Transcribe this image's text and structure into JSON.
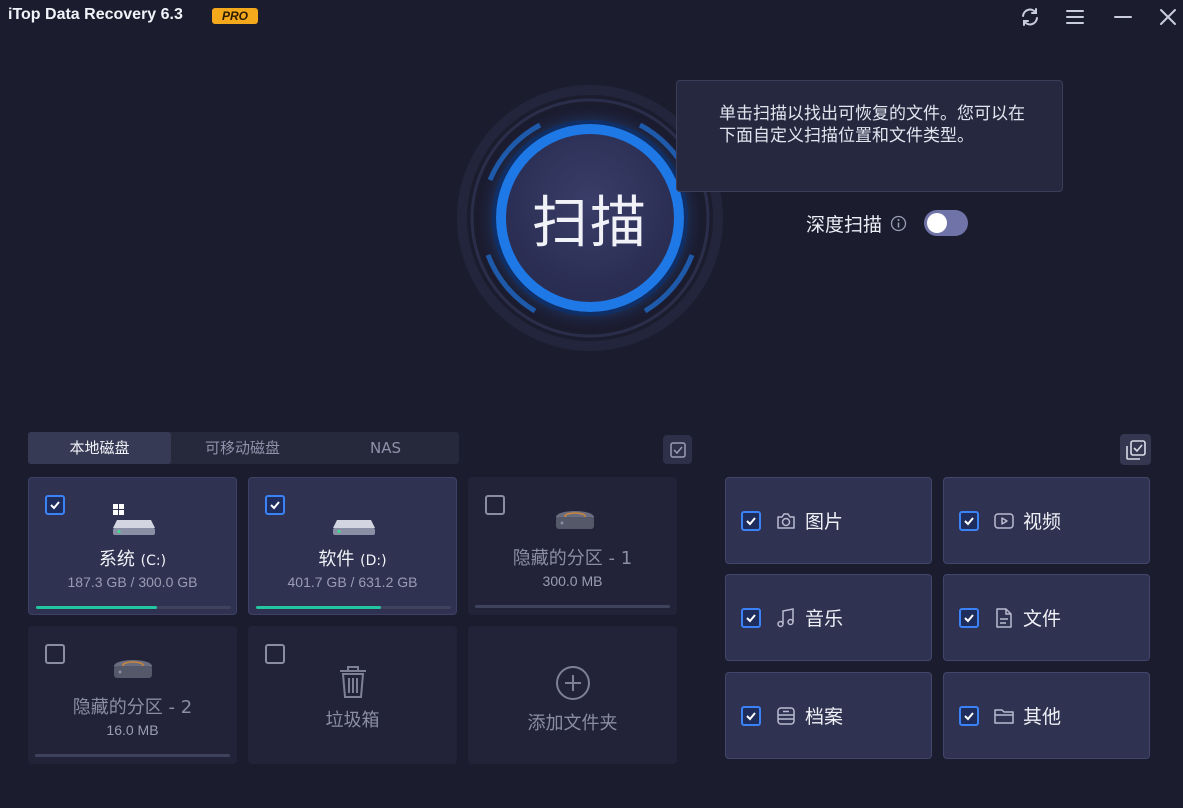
{
  "app": {
    "title": "iTop Data Recovery 6.3",
    "badge": "PRO"
  },
  "scan": {
    "button_label": "扫描",
    "tooltip": "单击扫描以找出可恢复的文件。您可以在下面自定义扫描位置和文件类型。",
    "deep_scan_label": "深度扫描",
    "deep_scan_enabled": false
  },
  "tabs": [
    "本地磁盘",
    "可移动磁盘",
    "NAS"
  ],
  "active_tab": 0,
  "drives": [
    {
      "name": "系统",
      "letter": "(C:)",
      "size": "187.3 GB / 300.0 GB",
      "usage": 0.62,
      "checked": true
    },
    {
      "name": "软件",
      "letter": "(D:)",
      "size": "401.7 GB / 631.2 GB",
      "usage": 0.64,
      "checked": true
    },
    {
      "name": "隐藏的分区 - 1",
      "size": "300.0 MB",
      "usage": 0,
      "checked": false
    },
    {
      "name": "隐藏的分区 - 2",
      "size": "16.0 MB",
      "usage": 0,
      "checked": false
    },
    {
      "name": "垃圾箱",
      "checked": false
    },
    {
      "name": "添加文件夹"
    }
  ],
  "file_types": [
    {
      "label": "图片",
      "icon": "camera-icon",
      "checked": true
    },
    {
      "label": "视频",
      "icon": "play-icon",
      "checked": true
    },
    {
      "label": "音乐",
      "icon": "music-note-icon",
      "checked": true
    },
    {
      "label": "文件",
      "icon": "document-icon",
      "checked": true
    },
    {
      "label": "档案",
      "icon": "archive-icon",
      "checked": true
    },
    {
      "label": "其他",
      "icon": "folder-icon",
      "checked": true
    }
  ],
  "colors": {
    "background": "#1c1c2f",
    "accent": "#1e78e6",
    "pro_badge": "#f4a81c",
    "usage_bar": "#24c6a0"
  }
}
